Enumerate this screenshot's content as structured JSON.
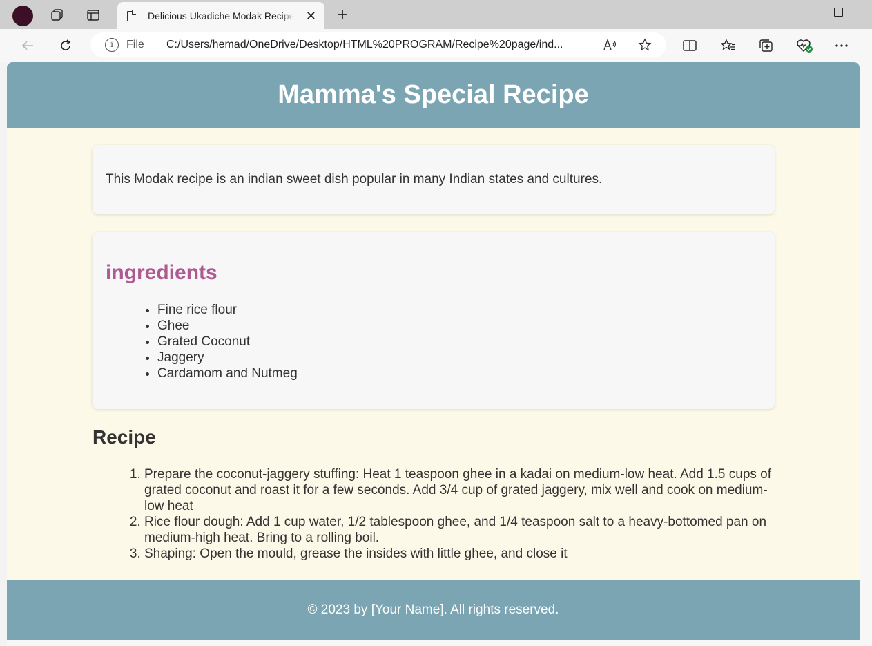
{
  "browser": {
    "tab_title": "Delicious Ukadiche Modak Recipe",
    "tab_close": "✕",
    "new_tab": "+",
    "address_prefix": "File",
    "address_url": "C:/Users/hemad/OneDrive/Desktop/HTML%20PROGRAM/Recipe%20page/ind...",
    "info_glyph": "i",
    "read_aloud_glyph": "A⁾"
  },
  "page": {
    "header_title": "Mamma's Special Recipe",
    "intro_text": "This Modak recipe is an indian sweet dish popular in many Indian states and cultures.",
    "ingredients_heading": "ingredients",
    "ingredients": [
      "Fine rice flour",
      "Ghee",
      "Grated Coconut",
      "Jaggery",
      "Cardamom and Nutmeg"
    ],
    "recipe_heading": "Recipe",
    "steps": [
      "Prepare the coconut-jaggery stuffing: Heat 1 teaspoon ghee in a kadai on medium-low heat. Add 1.5 cups of grated coconut and roast it for a few seconds. Add 3/4 cup of grated jaggery, mix well and cook on medium-low heat",
      "Rice flour dough: Add 1 cup water, 1/2 tablespoon ghee, and 1/4 teaspoon salt to a heavy-bottomed pan on medium-high heat. Bring to a rolling boil.",
      "Shaping: Open the mould, grease the insides with little ghee, and close it"
    ],
    "footer_text": "© 2023 by [Your Name]. All rights reserved."
  },
  "colors": {
    "header_bg": "#7ba5b2",
    "page_bg": "#fdf9e8",
    "card_bg": "#f7f7f7",
    "ingredients_heading": "#ae5a90",
    "text": "#333333"
  }
}
